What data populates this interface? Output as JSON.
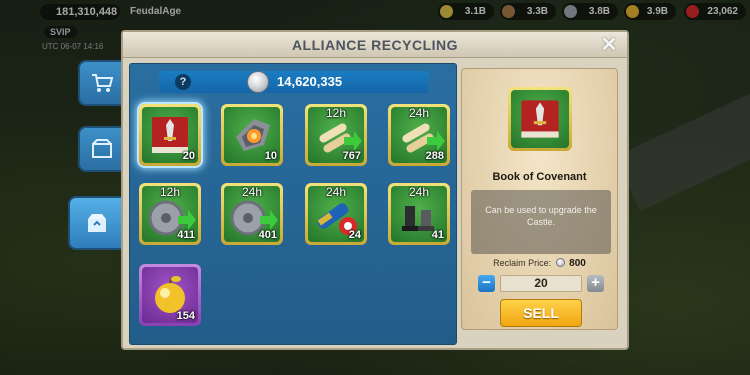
{
  "topbar": {
    "power": "181,310,448",
    "name": "FeudalAge",
    "vip": "SVIP",
    "utc": "UTC 06-07 14:16",
    "resources": [
      {
        "value": "3.1B",
        "color": "#d8c04a",
        "icon": "food-icon"
      },
      {
        "value": "3.3B",
        "color": "#a47a4a",
        "icon": "wood-icon"
      },
      {
        "value": "3.8B",
        "color": "#9fa6ad",
        "icon": "stone-icon"
      },
      {
        "value": "3.9B",
        "color": "#e0b030",
        "icon": "gold-icon"
      },
      {
        "value": "23,062",
        "color": "#d02a2a",
        "icon": "gem-icon"
      }
    ]
  },
  "panel": {
    "title": "ALLIANCE RECYCLING",
    "close_label": "✕",
    "balance": "14,620,335",
    "help_label": "?"
  },
  "side_tabs": [
    {
      "icon": "cart-icon",
      "active": false
    },
    {
      "icon": "box-icon",
      "active": false
    },
    {
      "icon": "recycle-box-icon",
      "active": true
    }
  ],
  "items": [
    {
      "name": "book-of-covenant",
      "qty": "20",
      "timer": "",
      "kind": "book"
    },
    {
      "name": "gem-shield",
      "qty": "10",
      "timer": "",
      "kind": "gem"
    },
    {
      "name": "speedup-12h",
      "qty": "767",
      "timer": "12h",
      "kind": "scroll"
    },
    {
      "name": "speedup-24h",
      "qty": "288",
      "timer": "24h",
      "kind": "scroll"
    },
    {
      "name": "wheel-12h",
      "qty": "411",
      "timer": "12h",
      "kind": "wheel"
    },
    {
      "name": "wheel-24h",
      "qty": "401",
      "timer": "24h",
      "kind": "wheel"
    },
    {
      "name": "telescope-24h",
      "qty": "24",
      "timer": "24h",
      "kind": "telescope"
    },
    {
      "name": "chess-24h",
      "qty": "41",
      "timer": "24h",
      "kind": "chess"
    },
    {
      "name": "golden-apple",
      "qty": "154",
      "timer": "",
      "kind": "apple"
    }
  ],
  "detail": {
    "name": "Book of Covenant",
    "description": "Can be used to upgrade the Castle.",
    "reclaim_label": "Reclaim Price:",
    "reclaim_price": "800",
    "quantity": "20",
    "minus_label": "−",
    "plus_label": "+",
    "sell_label": "SELL"
  }
}
